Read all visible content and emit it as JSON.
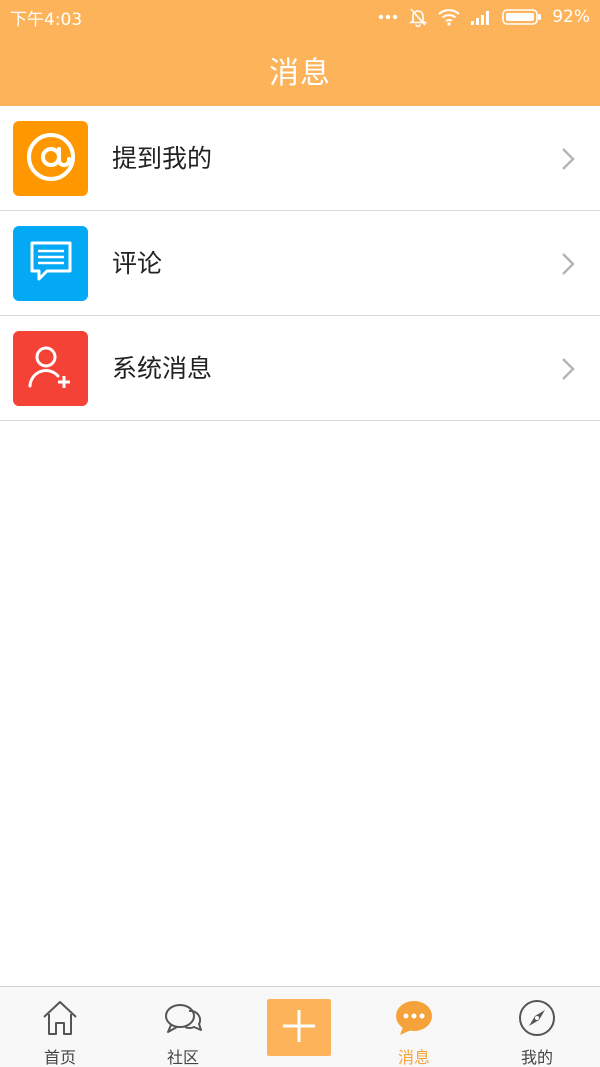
{
  "status_bar": {
    "time": "下午4:03",
    "battery": "92%"
  },
  "header": {
    "title": "消息"
  },
  "list": [
    {
      "label": "提到我的",
      "icon": "at-icon",
      "color": "#ff9800"
    },
    {
      "label": "评论",
      "icon": "comment-icon",
      "color": "#03a9f4"
    },
    {
      "label": "系统消息",
      "icon": "add-user-icon",
      "color": "#f44336"
    }
  ],
  "tabbar": {
    "tabs": [
      {
        "label": "首页",
        "icon": "home-icon"
      },
      {
        "label": "社区",
        "icon": "community-icon"
      },
      {
        "label": "",
        "icon": "add-icon"
      },
      {
        "label": "消息",
        "icon": "message-icon",
        "active": true
      },
      {
        "label": "我的",
        "icon": "compass-icon"
      }
    ],
    "active_color": "#f6a23a"
  },
  "colors": {
    "accent": "#fdb35a"
  }
}
